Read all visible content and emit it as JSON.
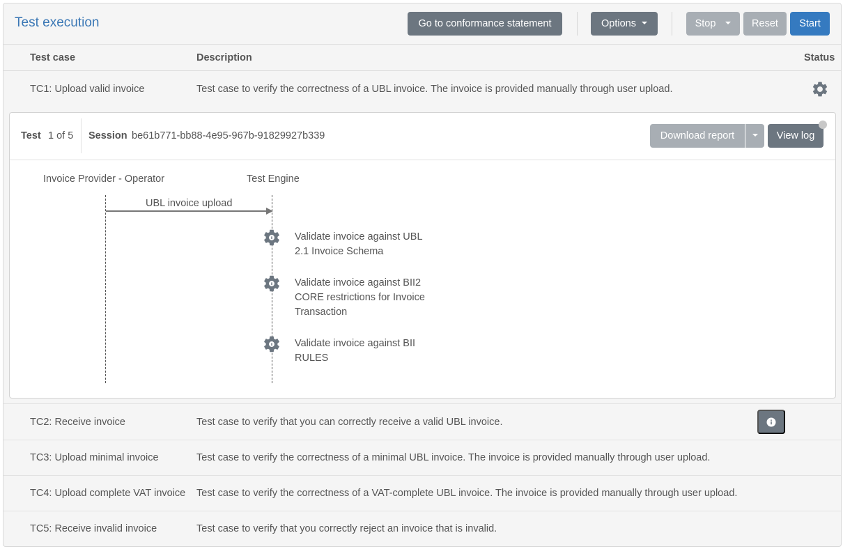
{
  "header": {
    "title": "Test execution",
    "conformance_label": "Go to conformance statement",
    "options_label": "Options",
    "stop_label": "Stop",
    "reset_label": "Reset",
    "start_label": "Start"
  },
  "table": {
    "columns": [
      "Test case",
      "Description",
      "Status"
    ],
    "rows": [
      {
        "name": "TC1: Upload valid invoice",
        "description": "Test case to verify the correctness of a UBL invoice. The invoice is provided manually through user upload.",
        "status_icon": "gear-icon"
      },
      {
        "name": "TC2: Receive invoice",
        "description": "Test case to verify that you can correctly receive a valid UBL invoice.",
        "status_icon": "info-icon"
      },
      {
        "name": "TC3: Upload minimal invoice",
        "description": "Test case to verify the correctness of a minimal UBL invoice. The invoice is provided manually through user upload."
      },
      {
        "name": "TC4: Upload complete VAT invoice",
        "description": "Test case to verify the correctness of a VAT-complete UBL invoice. The invoice is provided manually through user upload."
      },
      {
        "name": "TC5: Receive invalid invoice",
        "description": "Test case to verify that you correctly reject an invoice that is invalid."
      }
    ]
  },
  "session": {
    "test_label": "Test",
    "test_counter": "1 of 5",
    "session_label": "Session",
    "session_id": "be61b771-bb88-4e95-967b-91829927b339",
    "download_label": "Download report",
    "view_log_label": "View log"
  },
  "sequence": {
    "actors": [
      "Invoice Provider - Operator",
      "Test Engine"
    ],
    "message": "UBL invoice upload",
    "steps": [
      {
        "text": "Validate invoice against UBL 2.1 Invoice Schema",
        "icon": "gear-icon"
      },
      {
        "text": "Validate invoice against BII2 CORE restrictions for Invoice Transaction",
        "icon": "gear-icon"
      },
      {
        "text": "Validate invoice against BII RULES",
        "icon": "gear-icon"
      }
    ]
  },
  "colors": {
    "title": "#3a77b5",
    "primary": "#357ac0",
    "dark_button": "#6c7680",
    "disabled_button": "#a8aeb4"
  }
}
